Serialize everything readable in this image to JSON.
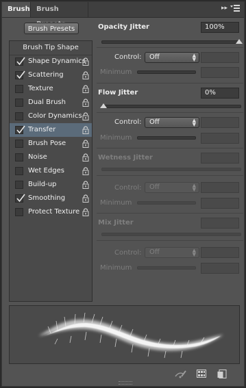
{
  "tabs": [
    {
      "label": "Brush",
      "active": true
    },
    {
      "label": "Brush Presets",
      "active": false
    }
  ],
  "tab_icons": {
    "collapse": "double-chevron-right-icon",
    "menu": "panel-menu-icon"
  },
  "brush_presets_button": "Brush Presets",
  "list": {
    "header": "Brush Tip Shape",
    "items": [
      {
        "label": "Shape Dynamics",
        "checked": true,
        "selected": false
      },
      {
        "label": "Scattering",
        "checked": true,
        "selected": false
      },
      {
        "label": "Texture",
        "checked": false,
        "selected": false
      },
      {
        "label": "Dual Brush",
        "checked": false,
        "selected": false
      },
      {
        "label": "Color Dynamics",
        "checked": false,
        "selected": false
      },
      {
        "label": "Transfer",
        "checked": true,
        "selected": true
      },
      {
        "label": "Brush Pose",
        "checked": false,
        "selected": false
      },
      {
        "label": "Noise",
        "checked": false,
        "selected": false
      },
      {
        "label": "Wet Edges",
        "checked": false,
        "selected": false
      },
      {
        "label": "Build-up",
        "checked": false,
        "selected": false
      },
      {
        "label": "Smoothing",
        "checked": true,
        "selected": false
      },
      {
        "label": "Protect Texture",
        "checked": false,
        "selected": false
      }
    ]
  },
  "opacity": {
    "title": "Opacity Jitter",
    "value": "100%",
    "control_label": "Control:",
    "control_value": "Off",
    "minimum_label": "Minimum"
  },
  "flow": {
    "title": "Flow Jitter",
    "value": "0%",
    "control_label": "Control:",
    "control_value": "Off",
    "minimum_label": "Minimum"
  },
  "wetness": {
    "title": "Wetness Jitter",
    "control_label": "Control:",
    "control_value": "Off",
    "minimum_label": "Minimum"
  },
  "mix": {
    "title": "Mix Jitter",
    "control_label": "Control:",
    "control_value": "Off",
    "minimum_label": "Minimum"
  },
  "bottom_icons": [
    "toggle-live-tip-icon",
    "grid-view-icon",
    "new-preset-icon"
  ],
  "colors": {
    "panel": "#535353",
    "selected_row": "#5b6b7a",
    "dim_text": "#7e7e7e"
  }
}
